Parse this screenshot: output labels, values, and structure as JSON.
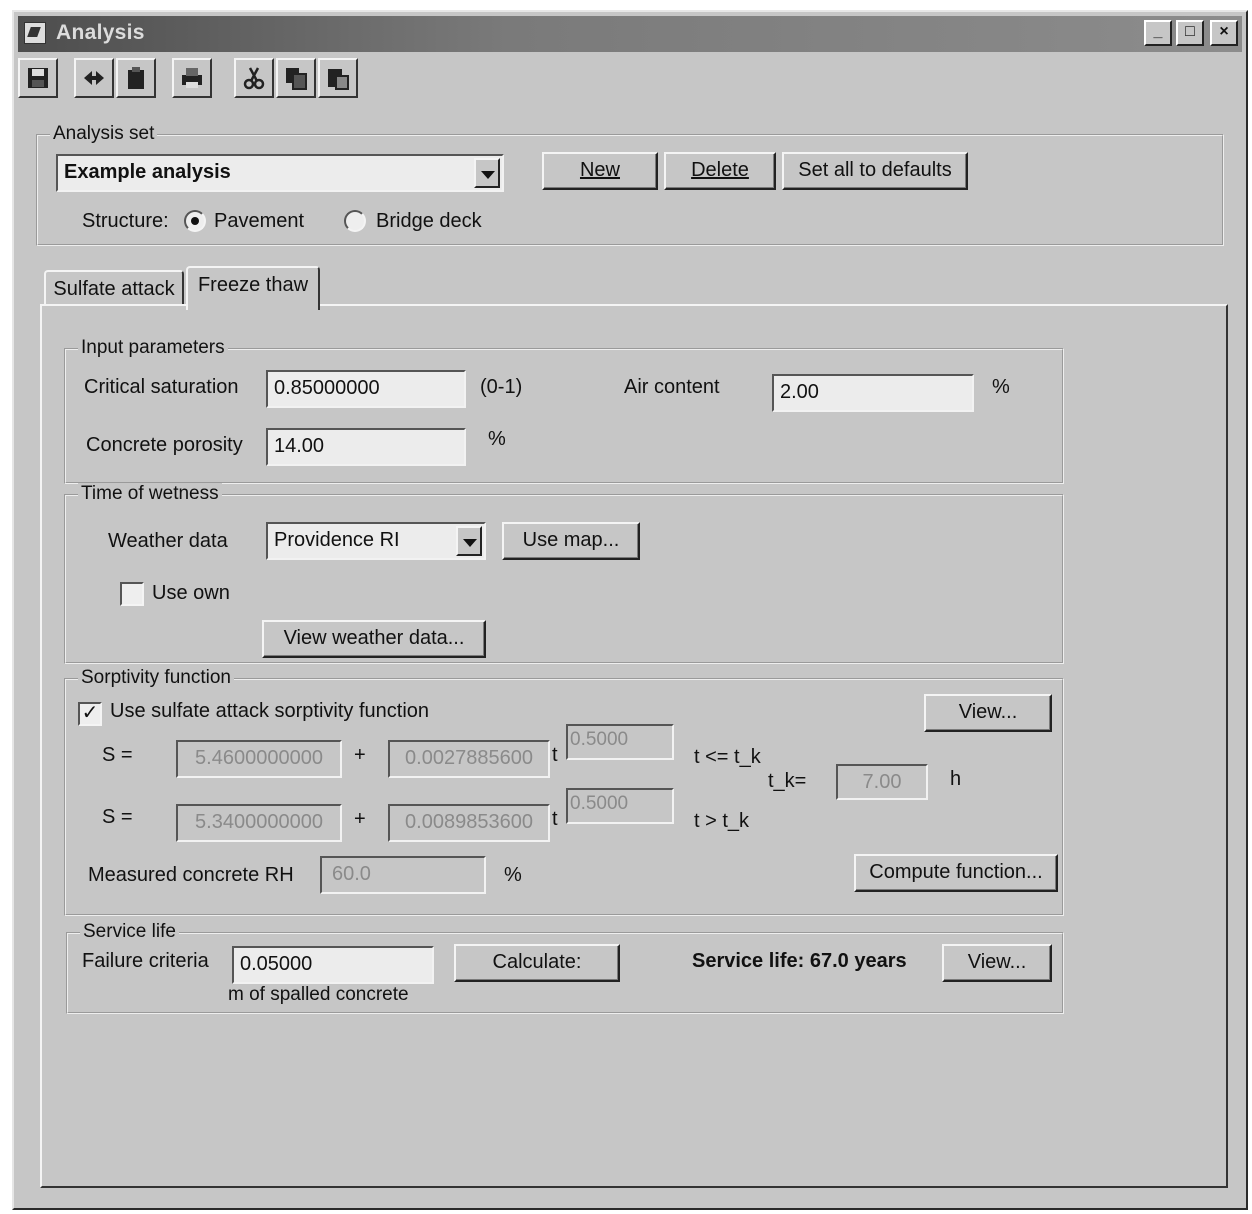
{
  "window": {
    "title": "Analysis"
  },
  "analysis_set": {
    "group_label": "Analysis set",
    "selected": "Example analysis",
    "new_label": "New",
    "delete_label": "Delete",
    "defaults_label": "Set all to defaults",
    "structure_label": "Structure:",
    "pavement_label": "Pavement",
    "bridge_label": "Bridge deck"
  },
  "tabs": [
    {
      "label": "Sulfate attack"
    },
    {
      "label": "Freeze thaw"
    }
  ],
  "input_parameters": {
    "group_label": "Input parameters",
    "critical_saturation_label": "Critical saturation",
    "critical_saturation_value": "0.85000000",
    "critical_saturation_unit": "(0-1)",
    "air_content_label": "Air content",
    "air_content_value": "2.00",
    "air_content_unit": "%",
    "porosity_label": "Concrete porosity",
    "porosity_value": "14.00",
    "porosity_unit": "%"
  },
  "time_of_wetness": {
    "group_label": "Time of wetness",
    "weather_label": "Weather data",
    "weather_value": "Providence RI",
    "use_map_label": "Use map...",
    "use_own_label": "Use own",
    "view_weather_label": "View weather data..."
  },
  "sorptivity": {
    "group_label": "Sorptivity function",
    "use_sulfate_label": "Use sulfate attack sorptivity function",
    "use_sulfate_checked": true,
    "view_label": "View...",
    "s_label": "S =",
    "plus": "+",
    "t": "t",
    "row1": {
      "a": "5.4600000000",
      "b": "0.0027885600",
      "exp": "0.5000",
      "cond": "t <= t_k"
    },
    "row2": {
      "a": "5.3400000000",
      "b": "0.0089853600",
      "exp": "0.5000",
      "cond": "t > t_k"
    },
    "tk_label": "t_k=",
    "tk_value": "7.00",
    "tk_unit": "h",
    "rh_label": "Measured concrete RH",
    "rh_value": "60.0",
    "rh_unit": "%",
    "compute_label": "Compute function..."
  },
  "service_life": {
    "group_label": "Service life",
    "failure_label": "Failure criteria",
    "failure_value": "0.05000",
    "failure_unit": "m of spalled concrete",
    "calculate_label": "Calculate:",
    "result": "Service life: 67.0 years",
    "view_label": "View..."
  }
}
